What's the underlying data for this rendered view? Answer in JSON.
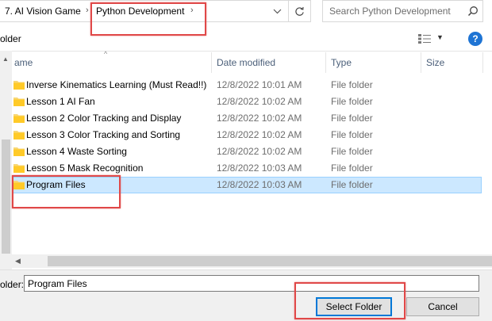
{
  "address_bar": {
    "breadcrumbs": [
      "7. AI Vision Game",
      "Python Development"
    ],
    "dropdown_icon": "chevron-down-icon",
    "refresh_icon": "refresh-icon"
  },
  "search": {
    "placeholder": "Search Python Development",
    "icon": "search-icon"
  },
  "toolbar": {
    "label": "older",
    "view_icon": "view-options-icon",
    "help_label": "?"
  },
  "columns": {
    "name": "ame",
    "date": "Date modified",
    "type": "Type",
    "size": "Size"
  },
  "files": [
    {
      "name": "Inverse Kinematics Learning (Must Read!!)",
      "date": "12/8/2022 10:01 AM",
      "type": "File folder",
      "selected": false
    },
    {
      "name": "Lesson 1 AI Fan",
      "date": "12/8/2022 10:02 AM",
      "type": "File folder",
      "selected": false
    },
    {
      "name": "Lesson 2 Color Tracking and Display",
      "date": "12/8/2022 10:02 AM",
      "type": "File folder",
      "selected": false
    },
    {
      "name": "Lesson 3 Color Tracking and Sorting",
      "date": "12/8/2022 10:02 AM",
      "type": "File folder",
      "selected": false
    },
    {
      "name": "Lesson 4 Waste Sorting",
      "date": "12/8/2022 10:02 AM",
      "type": "File folder",
      "selected": false
    },
    {
      "name": "Lesson 5 Mask Recognition",
      "date": "12/8/2022 10:03 AM",
      "type": "File folder",
      "selected": false
    },
    {
      "name": "Program Files",
      "date": "12/8/2022 10:03 AM",
      "type": "File folder",
      "selected": true
    }
  ],
  "bottom": {
    "folder_label": "older:",
    "folder_value": "Program Files",
    "select_label": "Select Folder",
    "cancel_label": "Cancel"
  },
  "colors": {
    "selection_bg": "#cce8ff",
    "highlight_box": "#e04848",
    "accent": "#0078d7"
  }
}
